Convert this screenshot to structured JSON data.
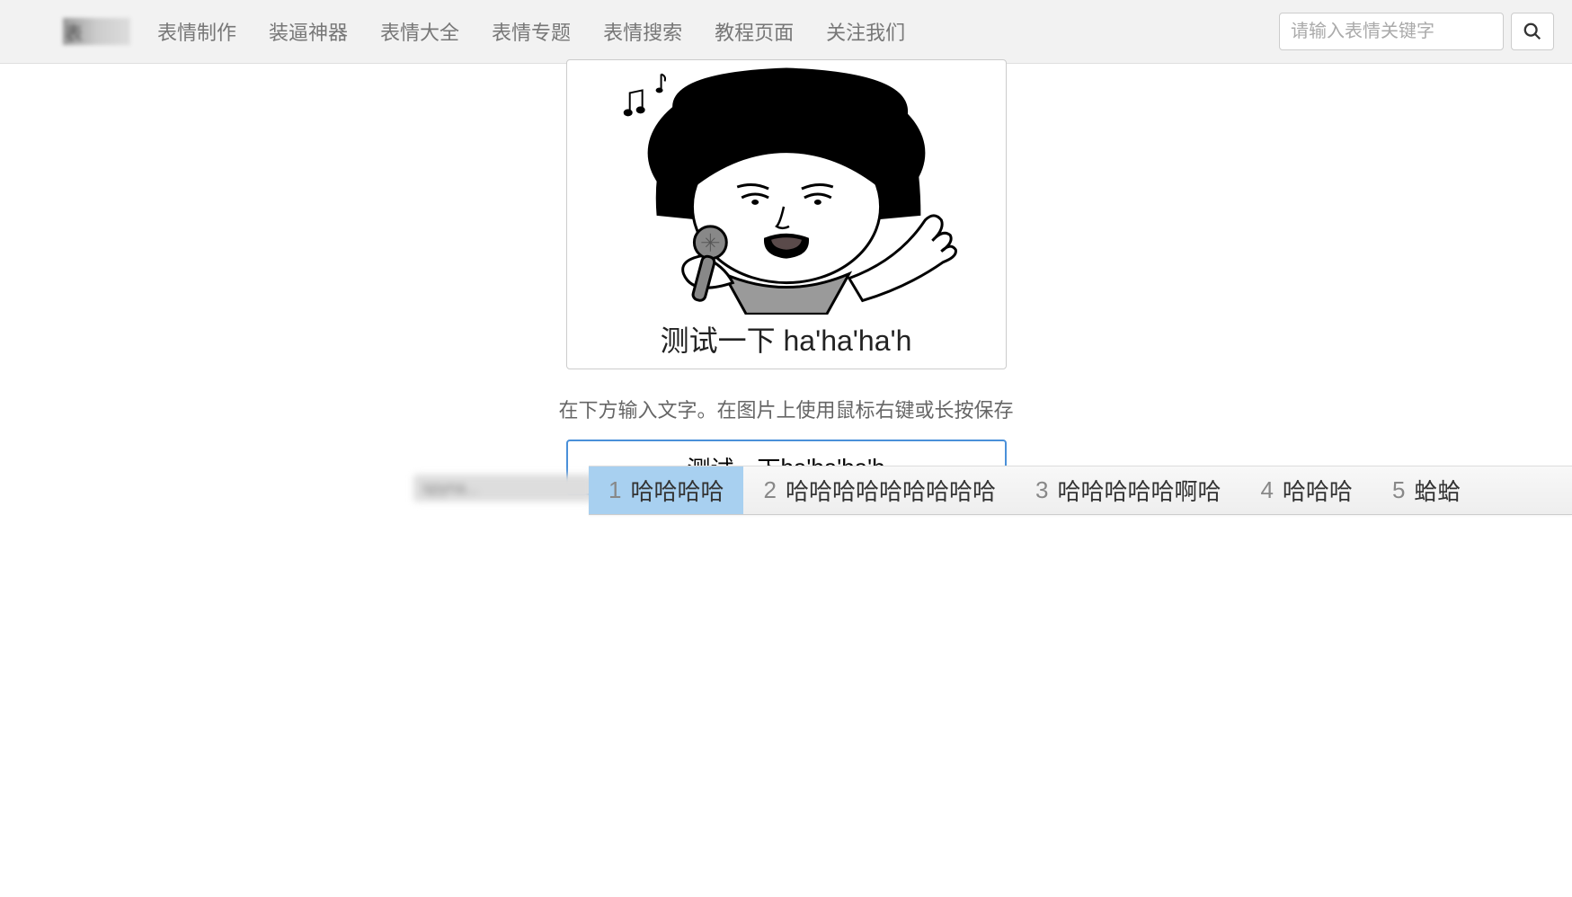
{
  "nav": {
    "logo_text": "表",
    "links": [
      "表情制作",
      "装逼神器",
      "表情大全",
      "表情专题",
      "表情搜索",
      "教程页面",
      "关注我们"
    ],
    "search_placeholder": "请输入表情关键字"
  },
  "meme": {
    "caption": "测试一下 ha'ha'ha'h"
  },
  "hint": "在下方输入文字。在图片上使用鼠标右键或长按保存",
  "input": {
    "committed": "测试一下 ",
    "composing": "ha'ha'ha'h"
  },
  "ime": {
    "candidates": [
      {
        "n": "1",
        "t": "哈哈哈哈"
      },
      {
        "n": "2",
        "t": "哈哈哈哈哈哈哈哈哈"
      },
      {
        "n": "3",
        "t": "哈哈哈哈哈啊哈"
      },
      {
        "n": "4",
        "t": "哈哈哈"
      },
      {
        "n": "5",
        "t": "蛤蛤"
      }
    ],
    "selected_index": 0
  }
}
